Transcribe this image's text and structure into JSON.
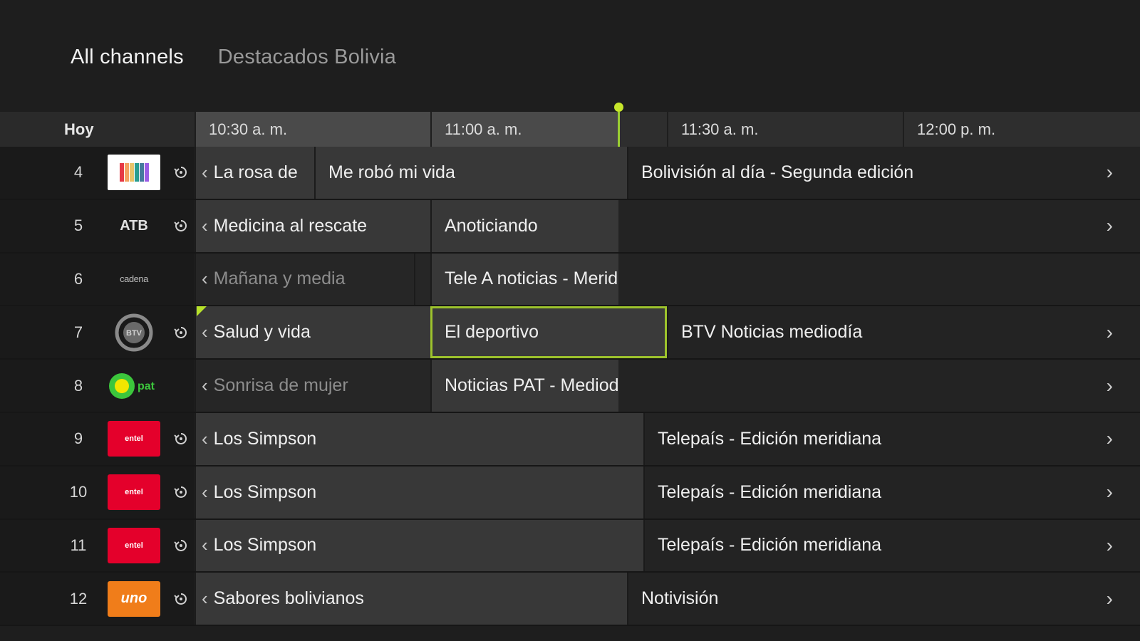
{
  "tabs": [
    {
      "label": "All channels",
      "active": true
    },
    {
      "label": "Destacados Bolivia",
      "active": false
    }
  ],
  "header": {
    "day_label": "Hoy",
    "times": [
      "10:30 a. m.",
      "11:00 a. m.",
      "11:30 a. m.",
      "12:00 p. m."
    ]
  },
  "channels": [
    {
      "number": "4",
      "logo": "bolivision-logo",
      "logo_text": "",
      "programs": [
        "La rosa de",
        "Me robó mi vida",
        "Bolivisión al día - Segunda edición"
      ]
    },
    {
      "number": "5",
      "logo": "atb-logo",
      "logo_text": "ATB",
      "programs": [
        "Medicina al rescate",
        "Anoticiando"
      ]
    },
    {
      "number": "6",
      "logo": "cadena-a-logo",
      "logo_text": "cadena",
      "programs": [
        "Mañana y media",
        "Tele A noticias - Meridiano"
      ]
    },
    {
      "number": "7",
      "logo": "btv-logo",
      "logo_text": "BTV",
      "programs": [
        "Salud y vida",
        "El deportivo",
        "BTV Noticias mediodía"
      ]
    },
    {
      "number": "8",
      "logo": "pat-logo",
      "logo_text": "pat",
      "programs": [
        "Sonrisa de mujer",
        "Noticias PAT - Mediodía"
      ]
    },
    {
      "number": "9",
      "logo": "entel-logo",
      "logo_text": "entel",
      "programs": [
        "Los Simpson",
        "Telepaís - Edición meridiana"
      ]
    },
    {
      "number": "10",
      "logo": "entel-logo",
      "logo_text": "entel",
      "programs": [
        "Los Simpson",
        "Telepaís - Edición meridiana"
      ]
    },
    {
      "number": "11",
      "logo": "entel-logo",
      "logo_text": "entel",
      "programs": [
        "Los Simpson",
        "Telepaís - Edición meridiana"
      ]
    },
    {
      "number": "12",
      "logo": "uno-logo",
      "logo_text": "uno",
      "programs": [
        "Sabores bolivianos",
        "Notivisión"
      ]
    }
  ],
  "colors": {
    "accent": "#9dc32c",
    "background": "#1e1e1e"
  },
  "icons": {
    "restart": "restart-icon",
    "prev": "chevron-left-icon",
    "next": "chevron-right-icon"
  }
}
